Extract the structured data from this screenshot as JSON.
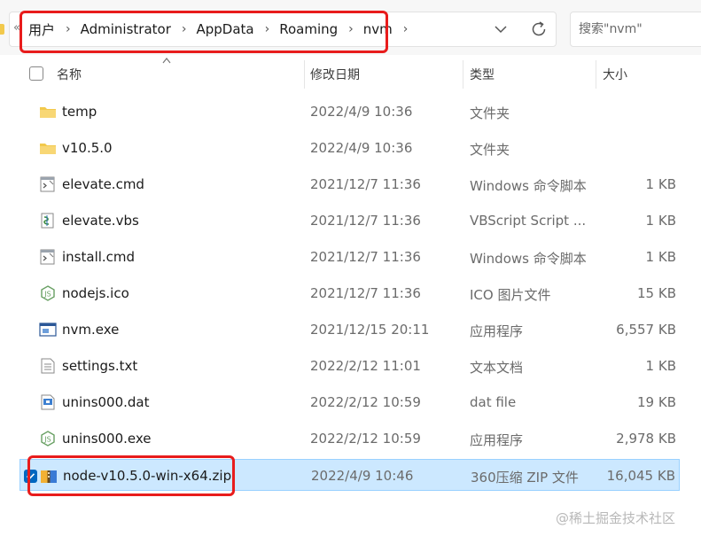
{
  "address_bar": {
    "overflow": "«",
    "crumbs": [
      "用户",
      "Administrator",
      "AppData",
      "Roaming",
      "nvm"
    ]
  },
  "search": {
    "placeholder": "搜索\"nvm\""
  },
  "columns": {
    "name": "名称",
    "date": "修改日期",
    "type": "类型",
    "size": "大小"
  },
  "files": [
    {
      "name": "temp",
      "date": "2022/4/9 10:36",
      "type": "文件夹",
      "size": "",
      "icon": "folder-icon"
    },
    {
      "name": "v10.5.0",
      "date": "2022/4/9 10:36",
      "type": "文件夹",
      "size": "",
      "icon": "folder-icon"
    },
    {
      "name": "elevate.cmd",
      "date": "2021/12/7 11:36",
      "type": "Windows 命令脚本",
      "size": "1 KB",
      "icon": "cmd-file-icon"
    },
    {
      "name": "elevate.vbs",
      "date": "2021/12/7 11:36",
      "type": "VBScript Script ...",
      "size": "1 KB",
      "icon": "vbs-file-icon"
    },
    {
      "name": "install.cmd",
      "date": "2021/12/7 11:36",
      "type": "Windows 命令脚本",
      "size": "1 KB",
      "icon": "cmd-file-icon"
    },
    {
      "name": "nodejs.ico",
      "date": "2021/12/7 11:36",
      "type": "ICO 图片文件",
      "size": "15 KB",
      "icon": "nodejs-icon"
    },
    {
      "name": "nvm.exe",
      "date": "2021/12/15 20:11",
      "type": "应用程序",
      "size": "6,557 KB",
      "icon": "exe-window-icon"
    },
    {
      "name": "settings.txt",
      "date": "2022/2/12 11:01",
      "type": "文本文档",
      "size": "1 KB",
      "icon": "text-file-icon"
    },
    {
      "name": "unins000.dat",
      "date": "2022/2/12 10:59",
      "type": "dat file",
      "size": "19 KB",
      "icon": "dat-file-icon"
    },
    {
      "name": "unins000.exe",
      "date": "2022/2/12 10:59",
      "type": "应用程序",
      "size": "2,978 KB",
      "icon": "nodejs-icon"
    },
    {
      "name": "node-v10.5.0-win-x64.zip",
      "date": "2022/4/9 10:46",
      "type": "360压缩 ZIP 文件",
      "size": "16,045 KB",
      "icon": "zip-archive-icon",
      "selected": true
    }
  ],
  "watermark": "@稀土掘金技术社区",
  "colors": {
    "selection_bg": "#cce8ff",
    "selection_border": "#99d1ff",
    "annotation_red": "#e81c1c",
    "folder_yellow": "#f2c94c"
  }
}
